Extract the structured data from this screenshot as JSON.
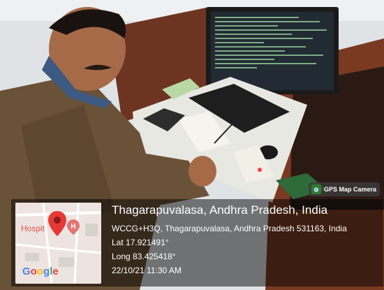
{
  "watermark": {
    "app_name": "GPS Map Camera",
    "place": "Thagarapuvalasa, Andhra Pradesh, India",
    "address": "WCCG+H3Q, Thagarapuvalasa, Andhra Pradesh 531163, India",
    "latitude": "Lat 17.921491°",
    "longitude": "Long 83.425418°",
    "datetime": "22/10/21 11:30 AM"
  },
  "map": {
    "poi_label": "Hospit",
    "brand": [
      "G",
      "o",
      "o",
      "g",
      "l",
      "e"
    ],
    "brand_colors": [
      "#4285F4",
      "#EA4335",
      "#FBBC05",
      "#4285F4",
      "#34A853",
      "#EA4335"
    ],
    "pin_color": "#E53935",
    "poi_marker_color": "#E57373"
  }
}
